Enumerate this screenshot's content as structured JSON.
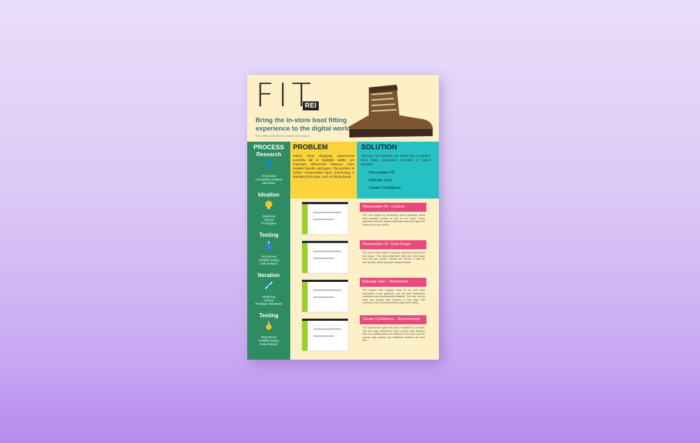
{
  "poster": {
    "title": "FIT",
    "tagline": "Bring the in-store boot fitting experience to the digital world.",
    "authors": "Phil Castillo  |  Kevin Martin  |  Thomas Wu  |  Isaac Ju",
    "logo_text": "REI",
    "process": {
      "title": "PROCESS",
      "steps": [
        {
          "label": "Research",
          "icon": "magnifier-icon",
          "items": [
            "Field study",
            "Competitive analysis",
            "Interviews"
          ]
        },
        {
          "label": "Ideation",
          "icon": "lightbulb-icon",
          "items": [
            "Sketching",
            "Critique",
            "Prototyping"
          ]
        },
        {
          "label": "Testing",
          "icon": "flask-icon",
          "items": [
            "Recruitment",
            "Usability testing",
            "Data analysis"
          ]
        },
        {
          "label": "Iteration",
          "icon": "tools-icon",
          "items": [
            "Sketching",
            "Critique",
            "Prototype refinement"
          ]
        },
        {
          "label": "Testing",
          "icon": "flask-icon",
          "items": [
            "Recruitment",
            "Usability testing",
            "Data analysis"
          ]
        }
      ]
    },
    "problem": {
      "title": "PROBLEM",
      "text": "Online shoe shopping experiences currently fail to highlight subtle, yet important differences between shoe models, brands, and types. This problem is further compounded when purchasing a specialty shoe type, such as hiking boots."
    },
    "solution": {
      "title": "SOLUTION",
      "text": "Through our research we found that a positive boot fitting experience provides 3 critical benefits:",
      "benefits": [
        "Personalize Fit",
        "Educate User",
        "Create Confidence"
      ]
    },
    "features": [
      {
        "title": "Personalize Fit - Context",
        "text": "The user begins by answering some questions about their intended context of use for the boots. These questions help the system determine what boot type and features the user needs."
      },
      {
        "title": "Personalize Fit - Foot Shape",
        "text": "The user is then asked to answer questions about their foot shape. This helps determine what size and shape boot the user needs. Tutorials are offered to help the user quickly obtain accurate measurements."
      },
      {
        "title": "Educate User - Summarize",
        "text": "The system then explains back to the user what information it has gathered, and how that information translates into recommended features. The user can go back and change their answers if they wish, and continue to the recommendation page when ready."
      },
      {
        "title": "Create Confidence - Recommend",
        "text": "The system then gives the user a selection of 3 boots. The blue tags attached to each explain what features from the questionnaire are included in the boot, and the orange tags explain any additional features the boot has."
      }
    ],
    "colors": {
      "green": "#2e8b62",
      "yellow": "#fbd33b",
      "teal": "#25c1c4",
      "pink": "#e84a7b",
      "cream": "#fdf0c6"
    }
  }
}
